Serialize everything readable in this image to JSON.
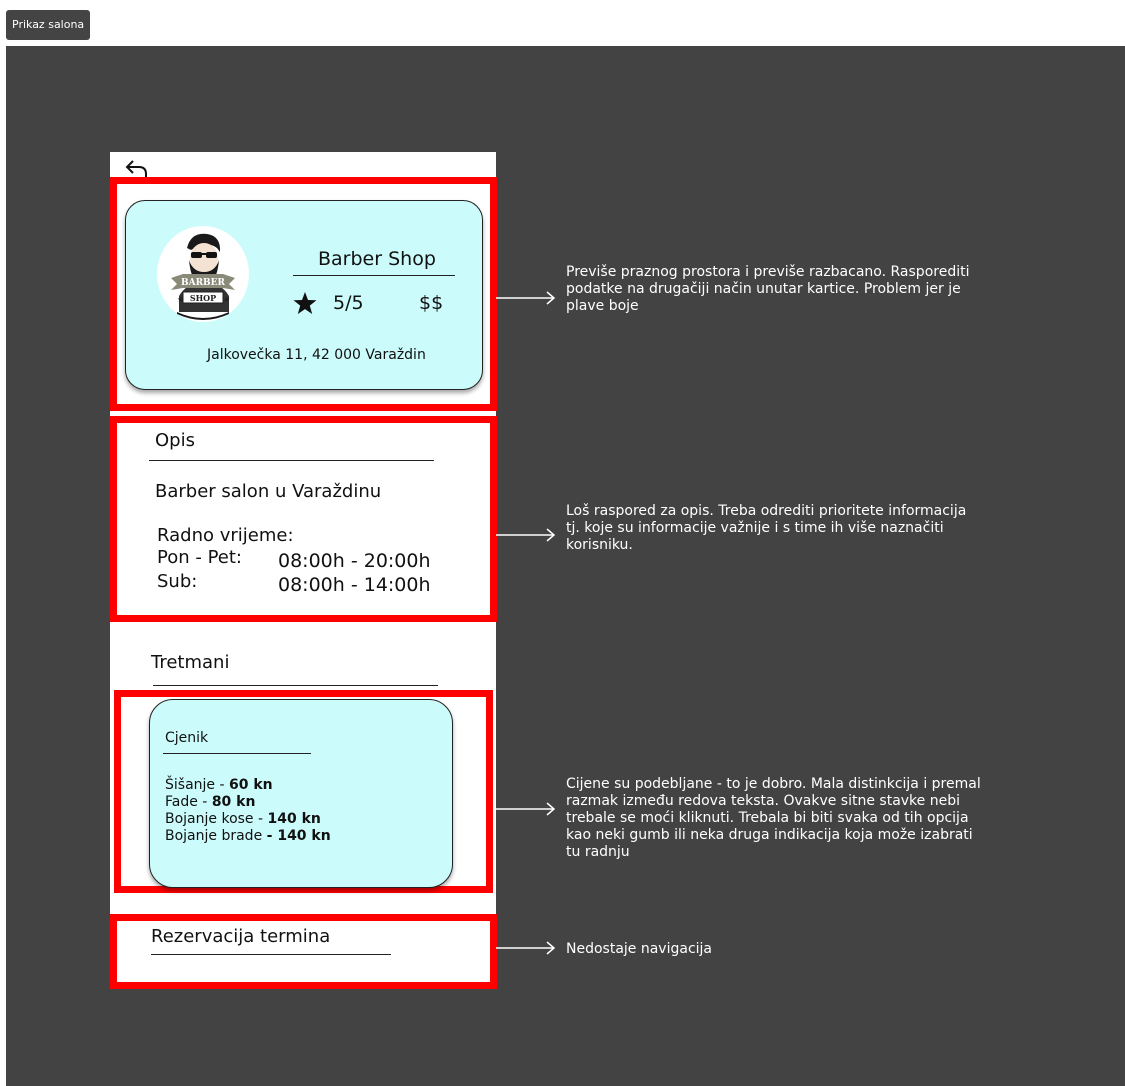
{
  "frame_tag": "Prikaz salona",
  "salon": {
    "name": "Barber Shop",
    "rating": "5/5",
    "price_level": "$$",
    "address": "Jalkovečka 11, 42 000 Varaždin",
    "logo_top_text": "BARBER",
    "logo_bottom_text": "SHOP"
  },
  "description": {
    "heading": "Opis",
    "text": "Barber salon u Varaždinu",
    "hours_label": "Radno vrijeme:",
    "hours": [
      {
        "day": "Pon - Pet:",
        "time": "08:00h - 20:00h"
      },
      {
        "day": "Sub:",
        "time": "08:00h - 14:00h"
      }
    ]
  },
  "treatments": {
    "heading": "Tretmani",
    "pricelist_title": "Cjenik",
    "items": [
      {
        "name": "Šišanje - ",
        "price": "60 kn"
      },
      {
        "name": "Fade - ",
        "price": "80 kn"
      },
      {
        "name": "Bojanje kose - ",
        "price": "140 kn"
      },
      {
        "name": "Bojanje brade ",
        "price": "- 140 kn"
      }
    ]
  },
  "reservation": {
    "heading": "Rezervacija termina"
  },
  "notes": [
    "Previše praznog prostora i previše razbacano. Rasporediti\npodatke na drugačiji način unutar kartice. Problem jer je\nplave boje",
    "Loš raspored za opis. Treba odrediti prioritete informacija\ntj. koje su informacije važnije i s time ih više naznačiti\nkorisniku.",
    "Cijene su podebljane - to je dobro. Mala distinkcija i premal\nrazmak između redova teksta. Ovakve sitne stavke nebi\ntrebale se moći kliknuti. Trebala bi biti svaka od tih opcija\nkao neki gumb ili neka druga indikacija koja može izabrati\ntu radnju",
    "Nedostaje navigacija"
  ],
  "colors": {
    "canvas": "#434343",
    "highlight_red": "#ff0000",
    "card_cyan": "#ccfbfb"
  },
  "icons": [
    "back-arrow-icon",
    "star-icon",
    "barber-logo",
    "arrow-right-icon"
  ]
}
